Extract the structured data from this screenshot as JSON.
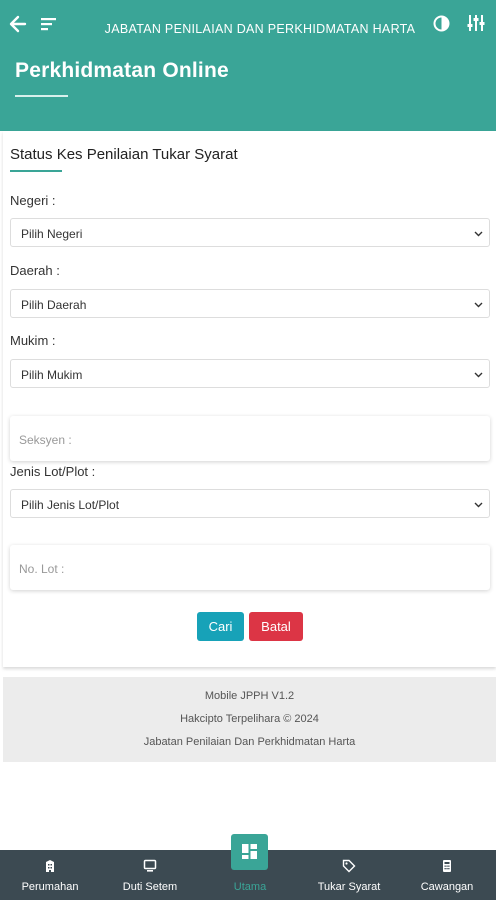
{
  "header": {
    "title": "JABATAN PENILAIAN DAN PERKHIDMATAN HARTA",
    "page_title": "Perkhidmatan Online",
    "icons": [
      "back-arrow-icon",
      "sort-icon",
      "contrast-icon",
      "tune-icon"
    ]
  },
  "form": {
    "section_title": "Status Kes Penilaian Tukar Syarat",
    "negeri": {
      "label": "Negeri :",
      "value": "Pilih Negeri"
    },
    "daerah": {
      "label": "Daerah :",
      "value": "Pilih Daerah"
    },
    "mukim": {
      "label": "Mukim :",
      "value": "Pilih Mukim"
    },
    "seksyen": {
      "placeholder": "Seksyen :"
    },
    "jenis_lot": {
      "label": "Jenis Lot/Plot :",
      "value": "Pilih Jenis Lot/Plot"
    },
    "no_lot": {
      "placeholder": "No. Lot :"
    },
    "buttons": {
      "search": "Cari",
      "cancel": "Batal"
    }
  },
  "footer": {
    "line1": "Mobile JPPH V1.2",
    "line2": "Hakcipto Terpelihara © 2024",
    "line3": "Jabatan Penilaian Dan Perkhidmatan Harta"
  },
  "nav": {
    "items": [
      {
        "label": "Perumahan",
        "icon": "building-icon"
      },
      {
        "label": "Duti Setem",
        "icon": "computer-icon"
      },
      {
        "label": "Utama",
        "icon": "dashboard-icon",
        "active": true
      },
      {
        "label": "Tukar Syarat",
        "icon": "tag-icon"
      },
      {
        "label": "Cawangan",
        "icon": "phone-icon"
      }
    ]
  },
  "colors": {
    "primary": "#3aa597",
    "nav_bg": "#3c4a52",
    "search_btn": "#17a2b8",
    "cancel_btn": "#dc3545"
  }
}
